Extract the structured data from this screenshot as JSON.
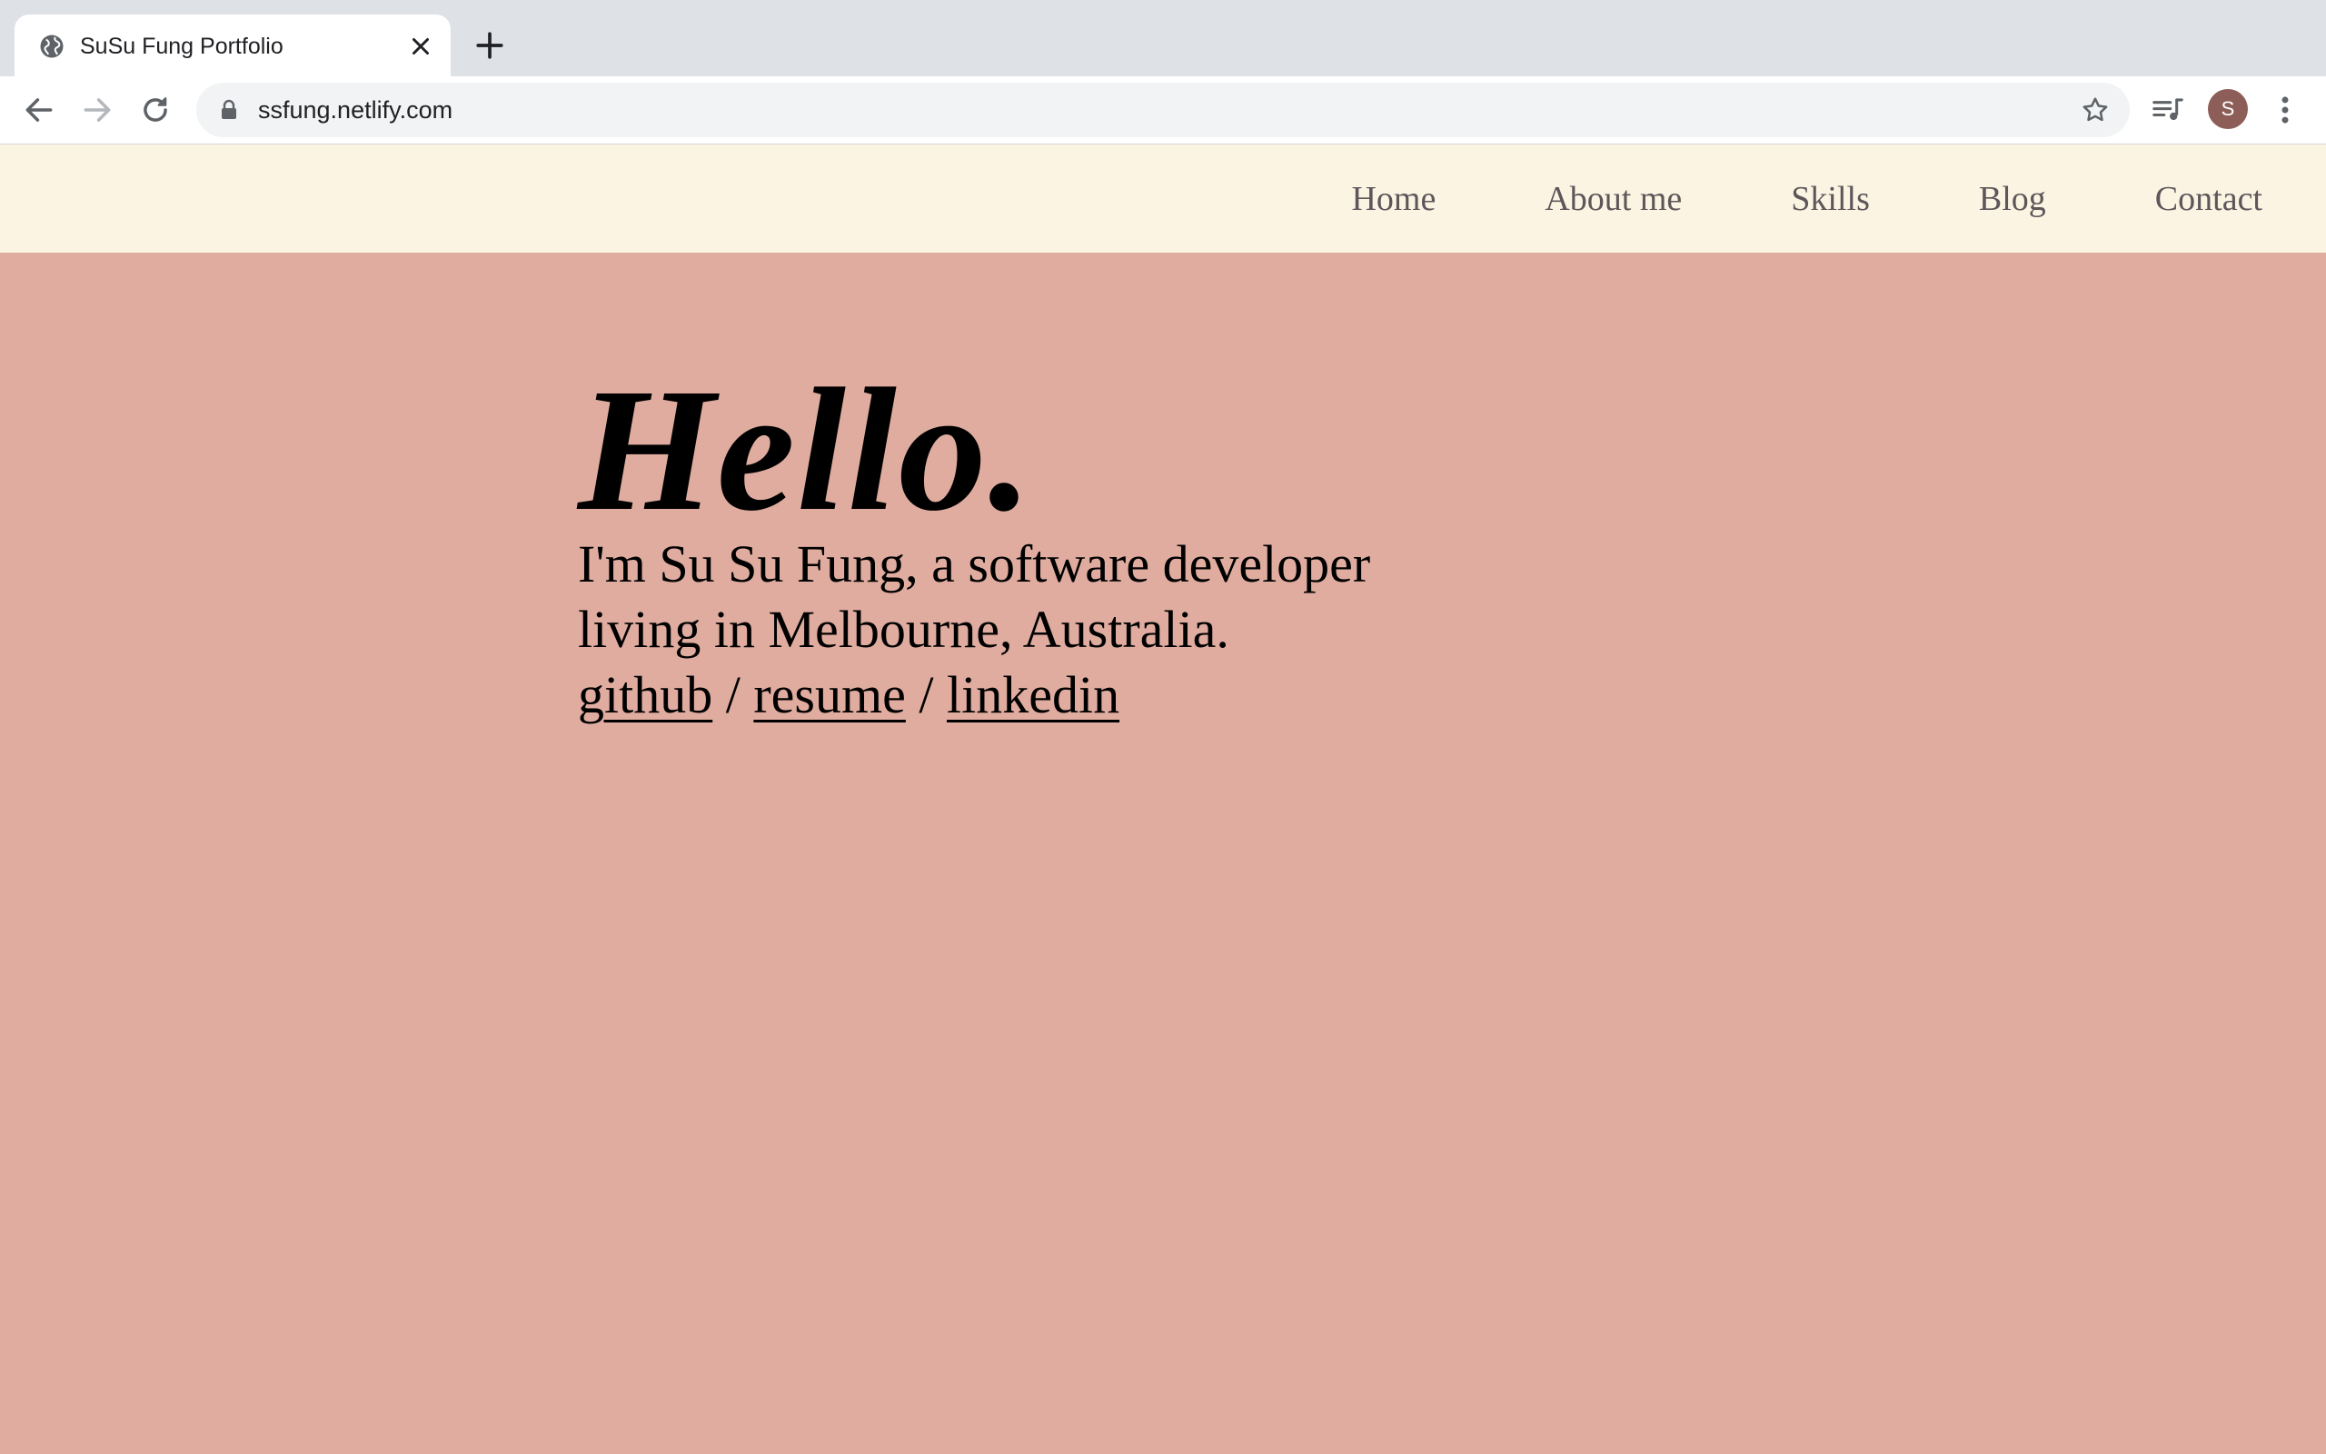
{
  "browser": {
    "tab_title": "SuSu Fung Portfolio",
    "url": "ssfung.netlify.com",
    "profile_initial": "S",
    "icons": {
      "tab_favicon": "globe-icon",
      "tab_close": "close-icon",
      "new_tab": "plus-icon",
      "back": "back-arrow-icon",
      "forward": "forward-arrow-icon",
      "reload": "reload-icon",
      "lock": "lock-icon",
      "bookmark": "star-icon",
      "media": "media-control-icon",
      "menu": "kebab-menu-icon"
    }
  },
  "nav": {
    "items": [
      {
        "label": "Home"
      },
      {
        "label": "About me"
      },
      {
        "label": "Skills"
      },
      {
        "label": "Blog"
      },
      {
        "label": "Contact"
      }
    ]
  },
  "hero": {
    "heading": "Hello.",
    "intro_line_1": "I'm Su Su Fung, a software developer",
    "intro_line_2": "living in Melbourne, Australia.",
    "links": {
      "github": "github",
      "resume": "resume",
      "linkedin": "linkedin",
      "separator": " / "
    }
  },
  "colors": {
    "page_background": "#e0ac9f",
    "nav_background": "#fcf4e3",
    "nav_text": "#5e5659",
    "text": "#000000",
    "avatar": "#8d5e57"
  }
}
